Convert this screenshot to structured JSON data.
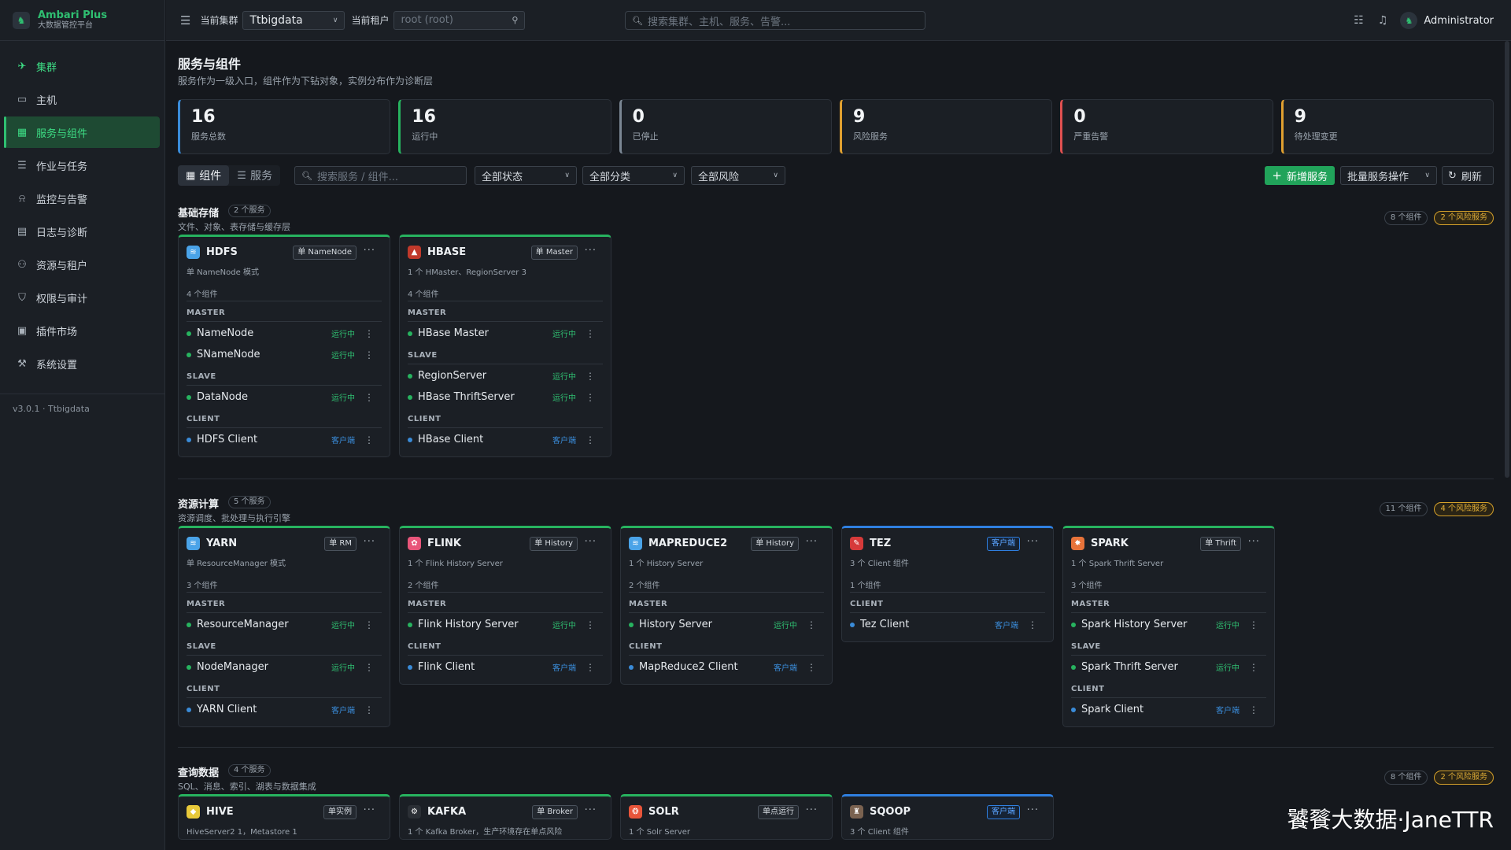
{
  "brand": {
    "title": "Ambari Plus",
    "subtitle": "大数据管控平台"
  },
  "nav": [
    {
      "label": "集群",
      "icon": "rocket-icon",
      "glyph": "✈",
      "state": "highlight"
    },
    {
      "label": "主机",
      "icon": "monitor-icon",
      "glyph": "▭",
      "state": ""
    },
    {
      "label": "服务与组件",
      "icon": "grid-icon",
      "glyph": "▦",
      "state": "active"
    },
    {
      "label": "作业与任务",
      "icon": "list-icon",
      "glyph": "☰",
      "state": ""
    },
    {
      "label": "监控与告警",
      "icon": "alarm-icon",
      "glyph": "⍾",
      "state": ""
    },
    {
      "label": "日志与诊断",
      "icon": "log-icon",
      "glyph": "▤",
      "state": ""
    },
    {
      "label": "资源与租户",
      "icon": "users-icon",
      "glyph": "⚇",
      "state": ""
    },
    {
      "label": "权限与审计",
      "icon": "shield-icon",
      "glyph": "⛉",
      "state": ""
    },
    {
      "label": "插件市场",
      "icon": "plugin-icon",
      "glyph": "▣",
      "state": ""
    },
    {
      "label": "系统设置",
      "icon": "wrench-icon",
      "glyph": "⚒",
      "state": ""
    }
  ],
  "version": "v3.0.1 · Ttbigdata",
  "topbar": {
    "cluster_label": "当前集群",
    "cluster_value": "Ttbigdata",
    "tenant_label": "当前租户",
    "tenant_placeholder": "root (root)",
    "search_placeholder": "搜索集群、主机、服务、告警...",
    "user": "Administrator"
  },
  "page": {
    "title": "服务与组件",
    "subtitle": "服务作为一级入口，组件作为下钻对象，实例分布作为诊断层"
  },
  "stats": [
    {
      "value": "16",
      "label": "服务总数",
      "color": "#3a8bd8"
    },
    {
      "value": "16",
      "label": "运行中",
      "color": "#27b35f"
    },
    {
      "value": "0",
      "label": "已停止",
      "color": "#7b8794"
    },
    {
      "value": "9",
      "label": "风险服务",
      "color": "#e0a030"
    },
    {
      "value": "0",
      "label": "严重告警",
      "color": "#e05050"
    },
    {
      "value": "9",
      "label": "待处理变更",
      "color": "#e0a030"
    }
  ],
  "toolbar": {
    "view_components": "组件",
    "view_services": "服务",
    "search_placeholder": "搜索服务 / 组件...",
    "filter_status": "全部状态",
    "filter_category": "全部分类",
    "filter_risk": "全部风险",
    "add_service": "新增服务",
    "batch_ops": "批量服务操作",
    "refresh": "刷新"
  },
  "groups": [
    {
      "title": "基础存储",
      "count": "2 个服务",
      "subtitle": "文件、对象、表存储与缓存层",
      "comp_count": "8 个组件",
      "risk": "2 个风险服务",
      "cards": [
        {
          "name": "HDFS",
          "icon_color": "#4aa3e8",
          "glyph": "≋",
          "mode": "单 NameNode",
          "mode_type": "normal",
          "top": "green",
          "desc": "单 NameNode 模式",
          "count": "4 个组件",
          "roles": [
            {
              "role": "MASTER",
              "items": [
                {
                  "name": "NameNode",
                  "status": "运行中",
                  "type": "run"
                },
                {
                  "name": "SNameNode",
                  "status": "运行中",
                  "type": "run"
                }
              ]
            },
            {
              "role": "SLAVE",
              "items": [
                {
                  "name": "DataNode",
                  "status": "运行中",
                  "type": "run"
                }
              ]
            },
            {
              "role": "CLIENT",
              "items": [
                {
                  "name": "HDFS Client",
                  "status": "客户端",
                  "type": "cli"
                }
              ]
            }
          ]
        },
        {
          "name": "HBASE",
          "icon_color": "#c0392b",
          "glyph": "▲",
          "mode": "单 Master",
          "mode_type": "normal",
          "top": "green",
          "desc": "1 个 HMaster、RegionServer 3",
          "count": "4 个组件",
          "roles": [
            {
              "role": "MASTER",
              "items": [
                {
                  "name": "HBase Master",
                  "status": "运行中",
                  "type": "run"
                }
              ]
            },
            {
              "role": "SLAVE",
              "items": [
                {
                  "name": "RegionServer",
                  "status": "运行中",
                  "type": "run"
                },
                {
                  "name": "HBase ThriftServer",
                  "status": "运行中",
                  "type": "run"
                }
              ]
            },
            {
              "role": "CLIENT",
              "items": [
                {
                  "name": "HBase Client",
                  "status": "客户端",
                  "type": "cli"
                }
              ]
            }
          ]
        }
      ]
    },
    {
      "title": "资源计算",
      "count": "5 个服务",
      "subtitle": "资源调度、批处理与执行引擎",
      "comp_count": "11 个组件",
      "risk": "4 个风险服务",
      "cards": [
        {
          "name": "YARN",
          "icon_color": "#4aa3e8",
          "glyph": "≋",
          "mode": "单 RM",
          "mode_type": "normal",
          "top": "green",
          "desc": "单 ResourceManager 模式",
          "count": "3 个组件",
          "roles": [
            {
              "role": "MASTER",
              "items": [
                {
                  "name": "ResourceManager",
                  "status": "运行中",
                  "type": "run"
                }
              ]
            },
            {
              "role": "SLAVE",
              "items": [
                {
                  "name": "NodeManager",
                  "status": "运行中",
                  "type": "run"
                }
              ]
            },
            {
              "role": "CLIENT",
              "items": [
                {
                  "name": "YARN Client",
                  "status": "客户端",
                  "type": "cli"
                }
              ]
            }
          ]
        },
        {
          "name": "FLINK",
          "icon_color": "#e8557a",
          "glyph": "✿",
          "mode": "单 History",
          "mode_type": "normal",
          "top": "green",
          "desc": "1 个 Flink History Server",
          "count": "2 个组件",
          "roles": [
            {
              "role": "MASTER",
              "items": [
                {
                  "name": "Flink History Server",
                  "status": "运行中",
                  "type": "run"
                }
              ]
            },
            {
              "role": "CLIENT",
              "items": [
                {
                  "name": "Flink Client",
                  "status": "客户端",
                  "type": "cli"
                }
              ]
            }
          ]
        },
        {
          "name": "MAPREDUCE2",
          "icon_color": "#4aa3e8",
          "glyph": "≋",
          "mode": "单 History",
          "mode_type": "normal",
          "top": "green",
          "desc": "1 个 History Server",
          "count": "2 个组件",
          "roles": [
            {
              "role": "MASTER",
              "items": [
                {
                  "name": "History Server",
                  "status": "运行中",
                  "type": "run"
                }
              ]
            },
            {
              "role": "CLIENT",
              "items": [
                {
                  "name": "MapReduce2 Client",
                  "status": "客户端",
                  "type": "cli"
                }
              ]
            }
          ]
        },
        {
          "name": "TEZ",
          "icon_color": "#d63a3a",
          "glyph": "✎",
          "mode": "客户端",
          "mode_type": "cli",
          "top": "blue",
          "desc": "3 个 Client 组件",
          "count": "1 个组件",
          "roles": [
            {
              "role": "CLIENT",
              "items": [
                {
                  "name": "Tez Client",
                  "status": "客户端",
                  "type": "cli"
                }
              ]
            }
          ]
        },
        {
          "name": "SPARK",
          "icon_color": "#e8733a",
          "glyph": "✸",
          "mode": "单 Thrift",
          "mode_type": "normal",
          "top": "green",
          "desc": "1 个 Spark Thrift Server",
          "count": "3 个组件",
          "roles": [
            {
              "role": "MASTER",
              "items": [
                {
                  "name": "Spark History Server",
                  "status": "运行中",
                  "type": "run"
                }
              ]
            },
            {
              "role": "SLAVE",
              "items": [
                {
                  "name": "Spark Thrift Server",
                  "status": "运行中",
                  "type": "run"
                }
              ]
            },
            {
              "role": "CLIENT",
              "items": [
                {
                  "name": "Spark Client",
                  "status": "客户端",
                  "type": "cli"
                }
              ]
            }
          ]
        }
      ]
    },
    {
      "title": "查询数据",
      "count": "4 个服务",
      "subtitle": "SQL、消息、索引、湖表与数据集成",
      "comp_count": "8 个组件",
      "risk": "2 个风险服务",
      "cards": [
        {
          "name": "HIVE",
          "icon_color": "#e8c93a",
          "glyph": "◆",
          "mode": "单实例",
          "mode_type": "normal",
          "top": "green",
          "desc": "HiveServer2 1，Metastore 1",
          "count": "",
          "roles": []
        },
        {
          "name": "KAFKA",
          "icon_color": "#2b2f35",
          "glyph": "⚙",
          "mode": "单 Broker",
          "mode_type": "normal",
          "top": "green",
          "desc": "1 个 Kafka Broker，生产环境存在单点风险",
          "count": "",
          "roles": []
        },
        {
          "name": "SOLR",
          "icon_color": "#e8553a",
          "glyph": "❂",
          "mode": "单点运行",
          "mode_type": "normal",
          "top": "green",
          "desc": "1 个 Solr Server",
          "count": "",
          "roles": []
        },
        {
          "name": "SQOOP",
          "icon_color": "#7a6250",
          "glyph": "♜",
          "mode": "客户端",
          "mode_type": "cli",
          "top": "blue",
          "desc": "3 个 Client 组件",
          "count": "",
          "roles": []
        }
      ]
    }
  ],
  "watermark": "饕餮大数据·JaneTTR"
}
